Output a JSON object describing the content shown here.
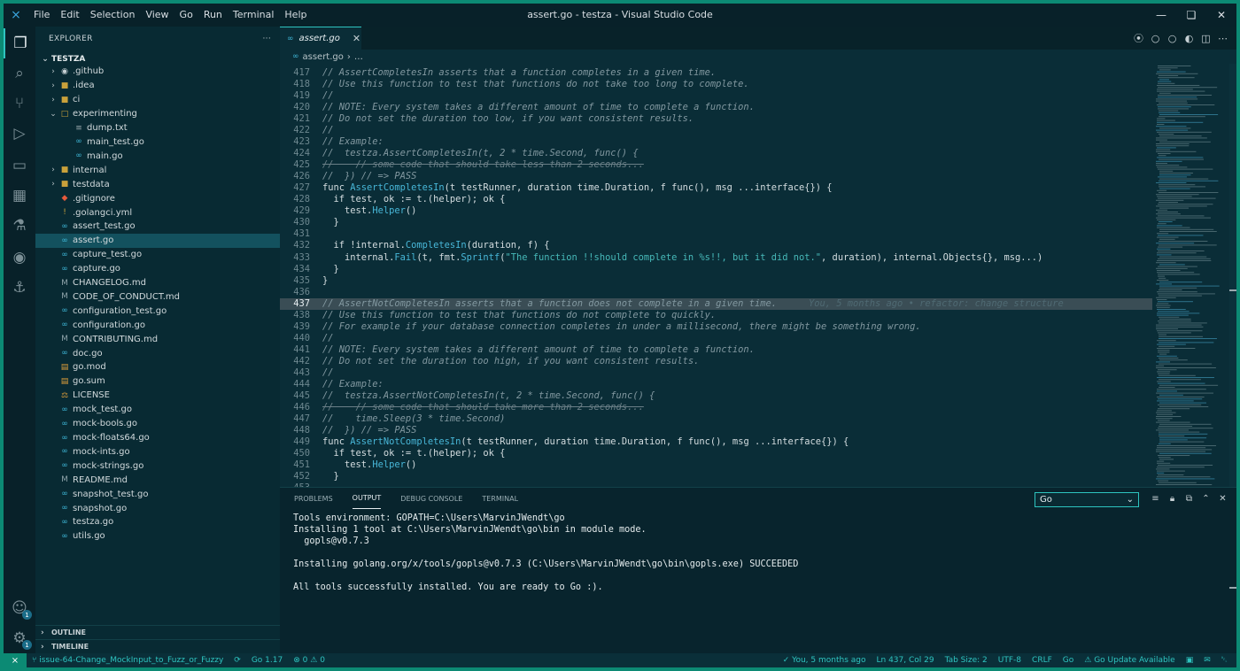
{
  "window": {
    "title": "assert.go - testza - Visual Studio Code",
    "menu": [
      "File",
      "Edit",
      "Selection",
      "View",
      "Go",
      "Run",
      "Terminal",
      "Help"
    ]
  },
  "explorer": {
    "header": "EXPLORER",
    "more": "···",
    "folder": "TESTZA",
    "items": [
      {
        "name": ".github",
        "type": "folder",
        "depth": 0,
        "icon": "github-folder-icon"
      },
      {
        "name": ".idea",
        "type": "folder",
        "depth": 0,
        "icon": "folder-icon"
      },
      {
        "name": "ci",
        "type": "folder",
        "depth": 0,
        "icon": "folder-icon"
      },
      {
        "name": "experimenting",
        "type": "folder-open",
        "depth": 0,
        "icon": "folder-open-icon"
      },
      {
        "name": "dump.txt",
        "type": "file",
        "depth": 1,
        "icon": "text-file-icon"
      },
      {
        "name": "main_test.go",
        "type": "file",
        "depth": 1,
        "icon": "go-file-icon"
      },
      {
        "name": "main.go",
        "type": "file",
        "depth": 1,
        "icon": "go-file-icon"
      },
      {
        "name": "internal",
        "type": "folder",
        "depth": 0,
        "icon": "folder-icon"
      },
      {
        "name": "testdata",
        "type": "folder",
        "depth": 0,
        "icon": "folder-icon"
      },
      {
        "name": ".gitignore",
        "type": "file",
        "depth": 0,
        "icon": "git-icon"
      },
      {
        "name": ".golangci.yml",
        "type": "file",
        "depth": 0,
        "icon": "yaml-icon"
      },
      {
        "name": "assert_test.go",
        "type": "file",
        "depth": 0,
        "icon": "go-file-icon"
      },
      {
        "name": "assert.go",
        "type": "file",
        "depth": 0,
        "icon": "go-file-icon",
        "selected": true
      },
      {
        "name": "capture_test.go",
        "type": "file",
        "depth": 0,
        "icon": "go-file-icon"
      },
      {
        "name": "capture.go",
        "type": "file",
        "depth": 0,
        "icon": "go-file-icon"
      },
      {
        "name": "CHANGELOG.md",
        "type": "file",
        "depth": 0,
        "icon": "markdown-icon"
      },
      {
        "name": "CODE_OF_CONDUCT.md",
        "type": "file",
        "depth": 0,
        "icon": "markdown-icon"
      },
      {
        "name": "configuration_test.go",
        "type": "file",
        "depth": 0,
        "icon": "go-file-icon"
      },
      {
        "name": "configuration.go",
        "type": "file",
        "depth": 0,
        "icon": "go-file-icon"
      },
      {
        "name": "CONTRIBUTING.md",
        "type": "file",
        "depth": 0,
        "icon": "markdown-icon"
      },
      {
        "name": "doc.go",
        "type": "file",
        "depth": 0,
        "icon": "go-file-icon"
      },
      {
        "name": "go.mod",
        "type": "file",
        "depth": 0,
        "icon": "gomod-icon"
      },
      {
        "name": "go.sum",
        "type": "file",
        "depth": 0,
        "icon": "gomod-icon"
      },
      {
        "name": "LICENSE",
        "type": "file",
        "depth": 0,
        "icon": "license-icon"
      },
      {
        "name": "mock_test.go",
        "type": "file",
        "depth": 0,
        "icon": "go-file-icon"
      },
      {
        "name": "mock-bools.go",
        "type": "file",
        "depth": 0,
        "icon": "go-file-icon"
      },
      {
        "name": "mock-floats64.go",
        "type": "file",
        "depth": 0,
        "icon": "go-file-icon"
      },
      {
        "name": "mock-ints.go",
        "type": "file",
        "depth": 0,
        "icon": "go-file-icon"
      },
      {
        "name": "mock-strings.go",
        "type": "file",
        "depth": 0,
        "icon": "go-file-icon"
      },
      {
        "name": "README.md",
        "type": "file",
        "depth": 0,
        "icon": "markdown-icon"
      },
      {
        "name": "snapshot_test.go",
        "type": "file",
        "depth": 0,
        "icon": "go-file-icon"
      },
      {
        "name": "snapshot.go",
        "type": "file",
        "depth": 0,
        "icon": "go-file-icon"
      },
      {
        "name": "testza.go",
        "type": "file",
        "depth": 0,
        "icon": "go-file-icon"
      },
      {
        "name": "utils.go",
        "type": "file",
        "depth": 0,
        "icon": "go-file-icon"
      }
    ],
    "outline": "OUTLINE",
    "timeline": "TIMELINE"
  },
  "editor": {
    "tab": "assert.go",
    "breadcrumb_file": "assert.go",
    "breadcrumb_rest": "…",
    "blame": "You, 5 months ago • refactor: change structure",
    "lines": [
      {
        "n": "417",
        "text": "// AssertCompletesIn asserts that a function completes in a given time."
      },
      {
        "n": "418",
        "text": "// Use this function to test that functions do not take too long to complete."
      },
      {
        "n": "419",
        "text": "//"
      },
      {
        "n": "420",
        "text": "// NOTE: Every system takes a different amount of time to complete a function."
      },
      {
        "n": "421",
        "text": "// Do not set the duration too low, if you want consistent results."
      },
      {
        "n": "422",
        "text": "//"
      },
      {
        "n": "423",
        "text": "// Example:"
      },
      {
        "n": "424",
        "text": "//  testza.AssertCompletesIn(t, 2 * time.Second, func() {"
      },
      {
        "n": "425",
        "text": "//    // some code that should take less than 2 seconds..."
      },
      {
        "n": "426",
        "text": "//  }) // => PASS"
      },
      {
        "n": "427",
        "text": "func AssertCompletesIn(t testRunner, duration time.Duration, f func(), msg ...interface{}) {"
      },
      {
        "n": "428",
        "text": "  if test, ok := t.(helper); ok {"
      },
      {
        "n": "429",
        "text": "    test.Helper()"
      },
      {
        "n": "430",
        "text": "  }"
      },
      {
        "n": "431",
        "text": ""
      },
      {
        "n": "432",
        "text": "  if !internal.CompletesIn(duration, f) {"
      },
      {
        "n": "433",
        "text": "    internal.Fail(t, fmt.Sprintf(\"The function !!should complete in %s!!, but it did not.\", duration), internal.Objects{}, msg...)"
      },
      {
        "n": "434",
        "text": "  }"
      },
      {
        "n": "435",
        "text": "}"
      },
      {
        "n": "436",
        "text": ""
      },
      {
        "n": "437",
        "text": "// AssertNotCompletesIn asserts that a function does not complete in a given time."
      },
      {
        "n": "438",
        "text": "// Use this function to test that functions do not complete to quickly."
      },
      {
        "n": "439",
        "text": "// For example if your database connection completes in under a millisecond, there might be something wrong."
      },
      {
        "n": "440",
        "text": "//"
      },
      {
        "n": "441",
        "text": "// NOTE: Every system takes a different amount of time to complete a function."
      },
      {
        "n": "442",
        "text": "// Do not set the duration too high, if you want consistent results."
      },
      {
        "n": "443",
        "text": "//"
      },
      {
        "n": "444",
        "text": "// Example:"
      },
      {
        "n": "445",
        "text": "//  testza.AssertNotCompletesIn(t, 2 * time.Second, func() {"
      },
      {
        "n": "446",
        "text": "//    // some code that should take more than 2 seconds..."
      },
      {
        "n": "447",
        "text": "//    time.Sleep(3 * time.Second)"
      },
      {
        "n": "448",
        "text": "//  }) // => PASS"
      },
      {
        "n": "449",
        "text": "func AssertNotCompletesIn(t testRunner, duration time.Duration, f func(), msg ...interface{}) {"
      },
      {
        "n": "450",
        "text": "  if test, ok := t.(helper); ok {"
      },
      {
        "n": "451",
        "text": "    test.Helper()"
      },
      {
        "n": "452",
        "text": "  }"
      },
      {
        "n": "453",
        "text": ""
      }
    ]
  },
  "panel": {
    "tabs": [
      "PROBLEMS",
      "OUTPUT",
      "DEBUG CONSOLE",
      "TERMINAL"
    ],
    "active_tab": "OUTPUT",
    "channel": "Go",
    "output": [
      "Tools environment: GOPATH=C:\\Users\\MarvinJWendt\\go",
      "Installing 1 tool at C:\\Users\\MarvinJWendt\\go\\bin in module mode.",
      "  gopls@v0.7.3",
      "",
      "Installing golang.org/x/tools/gopls@v0.7.3 (C:\\Users\\MarvinJWendt\\go\\bin\\gopls.exe) SUCCEEDED",
      "",
      "All tools successfully installed. You are ready to Go :)."
    ]
  },
  "status": {
    "branch": "issue-64-Change_MockInput_to_Fuzz_or_Fuzzy",
    "go_version": "Go 1.17",
    "problems": "0",
    "warnings": "0",
    "blame": "You, 5 months ago",
    "position": "Ln 437, Col 29",
    "tab_size": "Tab Size: 2",
    "encoding": "UTF-8",
    "eol": "CRLF",
    "language": "Go",
    "go_update": "Go Update Available"
  },
  "colors": {
    "accent": "#2ec4c0",
    "background": "#0a2d37",
    "function": "#48b7d8",
    "comment": "#8298a0"
  },
  "activity_badges": {
    "accounts": "1",
    "settings": "1"
  }
}
